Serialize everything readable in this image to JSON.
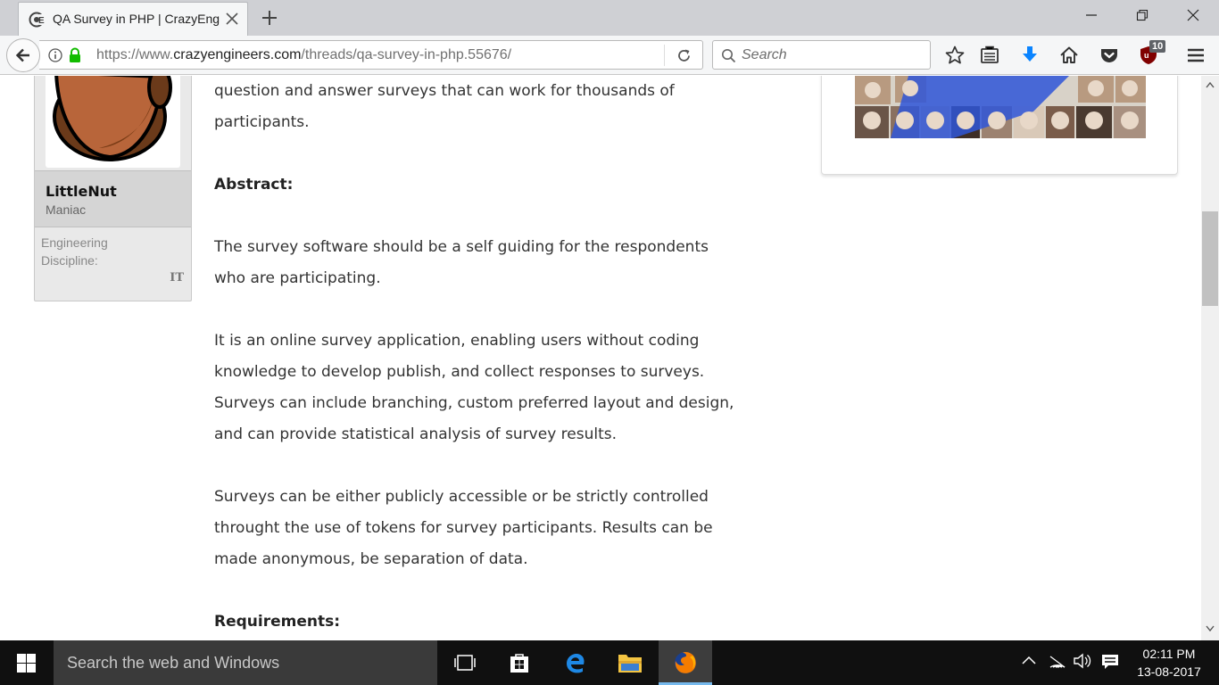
{
  "browser": {
    "tab_title": "QA Survey in PHP | CrazyEng",
    "url_prefix": "https://www.",
    "url_host": "crazyengineers.com",
    "url_path": "/threads/qa-survey-in-php.55676/",
    "search_placeholder": "Search",
    "ublock_badge": "10"
  },
  "user": {
    "name": "LittleNut",
    "rank": "Maniac",
    "discipline_label": "Engineering Discipline:",
    "discipline_value": "IT"
  },
  "post": {
    "p1_line1": "question and answer surveys that can work for thousands of",
    "p1_line2": "participants.",
    "abstract_heading": "Abstract:",
    "p2_line1": "The survey software should be a self guiding for the respondents",
    "p2_line2": "who are participating.",
    "p3_line1": "It is an online survey application, enabling users without coding",
    "p3_line2": "knowledge to develop publish, and collect responses to surveys.",
    "p3_line3": "Surveys can include branching, custom preferred layout and design,",
    "p3_line4": "and can provide statistical analysis of survey results.",
    "p4_line1": "Surveys can be either publicly accessible or be strictly controlled",
    "p4_line2": "throught the use of tokens for survey participants. Results can be",
    "p4_line3": "made anonymous, be separation of data.",
    "requirements_heading": "Requirements:"
  },
  "taskbar": {
    "search_placeholder": "Search the web and Windows",
    "time": "02:11 PM",
    "date": "13-08-2017"
  },
  "colors": {
    "accent_blue": "#0a84ff",
    "ublock_red": "#800000",
    "taskbar_bg": "#101010"
  }
}
